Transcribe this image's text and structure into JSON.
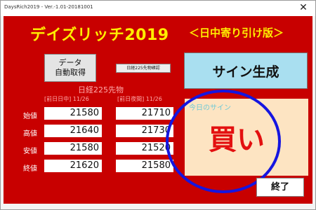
{
  "window": {
    "title": "DaysRich2019 - Ver.-1.01-20181001",
    "close_glyph": "✕"
  },
  "app": {
    "title": "デイズリッチ2019",
    "subtitle": "＜日中寄り引け版＞"
  },
  "buttons": {
    "fetch_line1": "データ",
    "fetch_line2": "自動取得",
    "small_label": "日経225先物確認",
    "sign_label": "サイン生成",
    "exit_label": "終了"
  },
  "prices": {
    "title": "日経225先物",
    "col_day": "[前日日中] 11/26",
    "col_night": "[前日夜間] 11/26",
    "rows": [
      {
        "label": "始値",
        "day": "21580",
        "night": "21710"
      },
      {
        "label": "高値",
        "day": "21640",
        "night": "21730"
      },
      {
        "label": "安値",
        "day": "21580",
        "night": "21520"
      },
      {
        "label": "終値",
        "day": "21620",
        "night": "21580"
      }
    ]
  },
  "result": {
    "label": "今日のサイン",
    "value": "買い"
  },
  "colors": {
    "panel": "#c80000",
    "title": "#ffee00",
    "sign_button": "#a9dff0",
    "result_bg": "#fde4c2",
    "result_text": "#e31010",
    "annotation_circle": "#1515e0"
  }
}
